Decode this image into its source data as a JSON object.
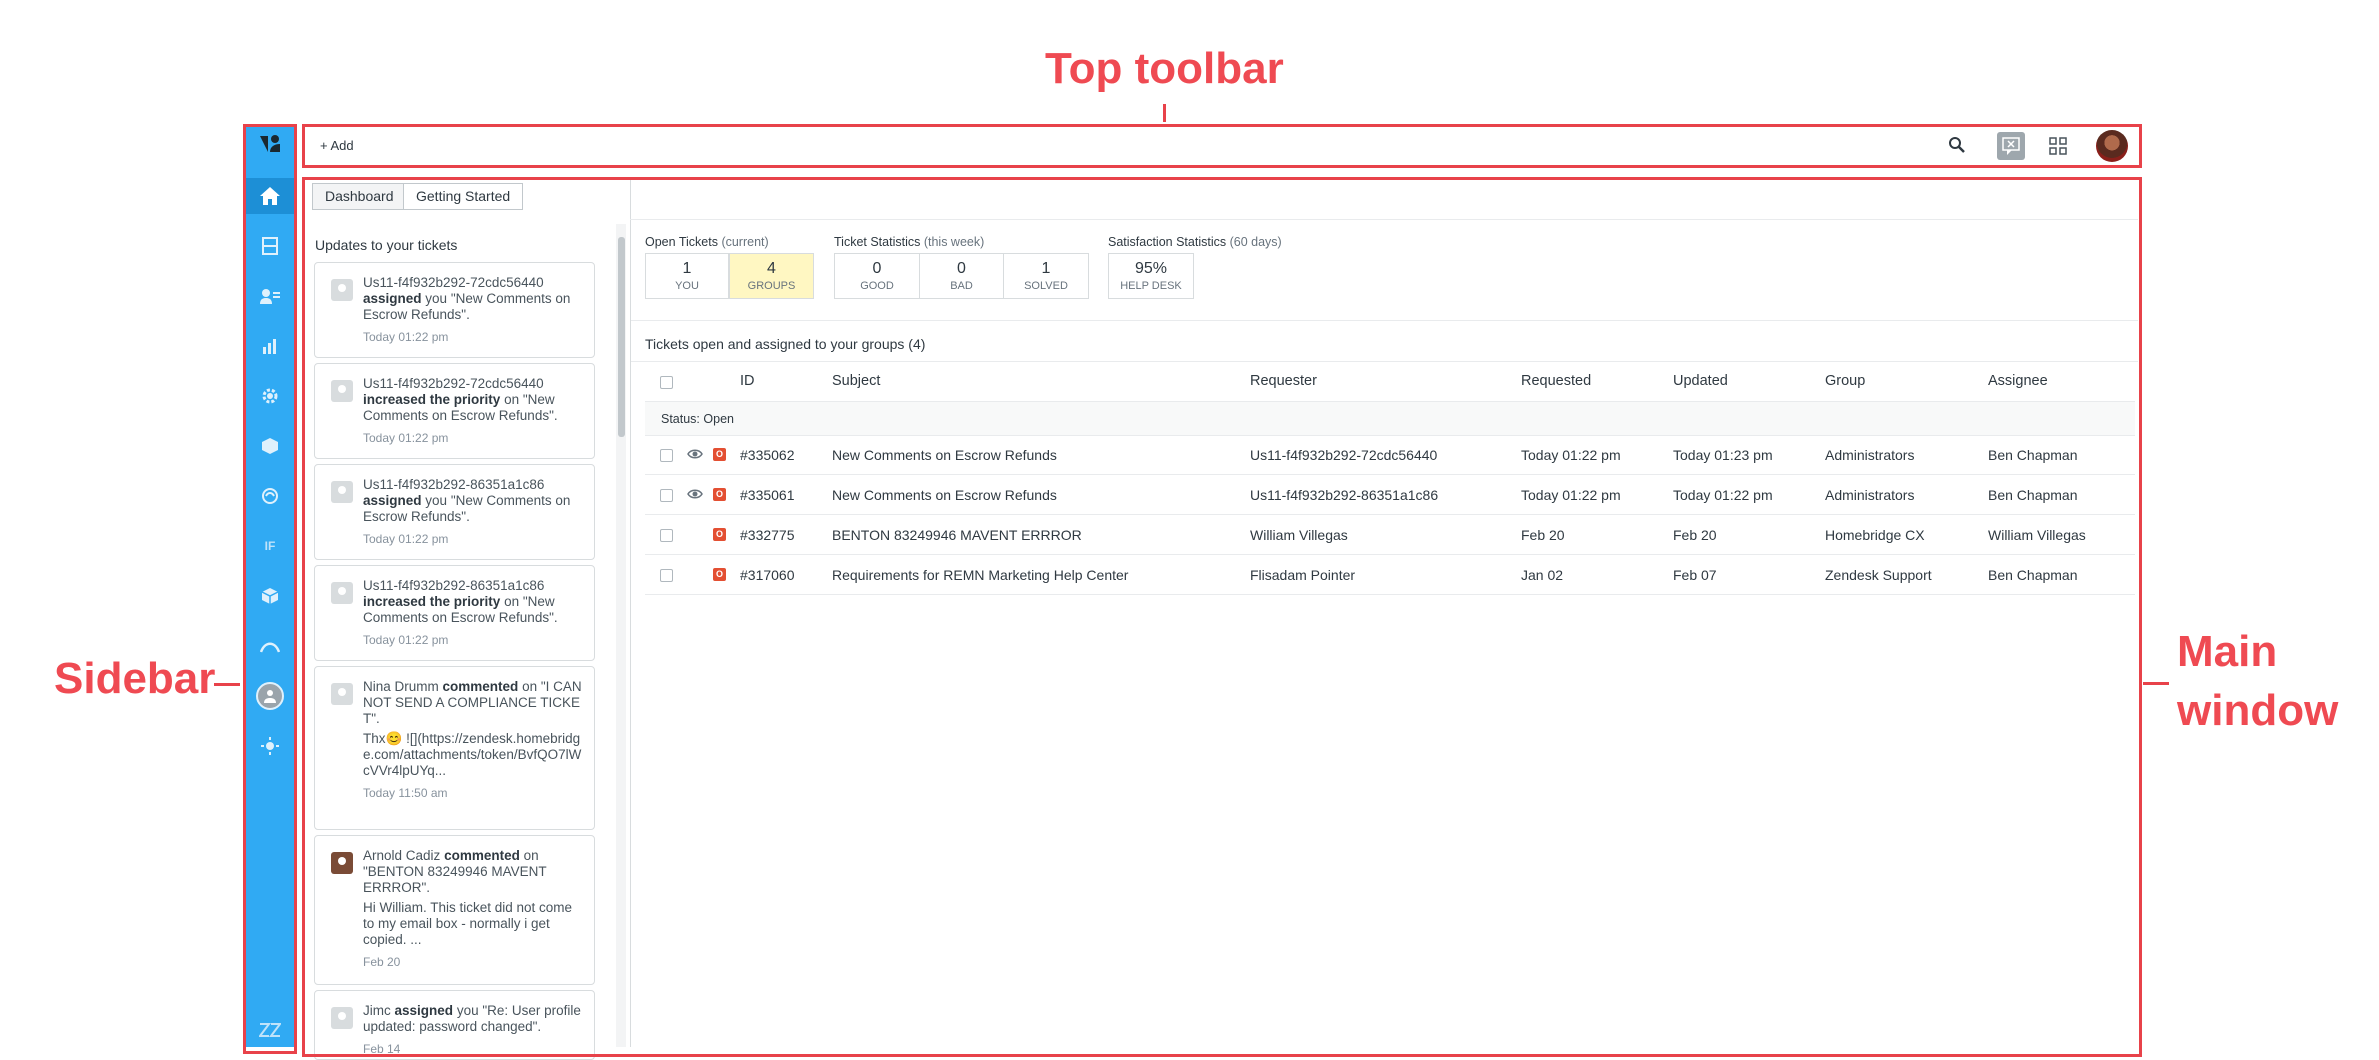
{
  "callouts": {
    "top_toolbar": "Top toolbar",
    "sidebar": "Sidebar",
    "main_window_line1": "Main",
    "main_window_line2": "window"
  },
  "toolbar": {
    "add_label": "+ Add"
  },
  "tabs": [
    {
      "label": "Dashboard"
    },
    {
      "label": "Getting Started"
    }
  ],
  "updates": {
    "heading": "Updates to your tickets",
    "items": [
      {
        "actor": "Us11-f4f932b292-72cdc56440",
        "action": "assigned",
        "rest": "you \"New Comments on Escrow Refunds\".",
        "time": "Today 01:22 pm"
      },
      {
        "actor": "Us11-f4f932b292-72cdc56440",
        "action": "increased the priority",
        "rest": "on \"New Comments on Escrow Refunds\".",
        "time": "Today 01:22 pm"
      },
      {
        "actor": "Us11-f4f932b292-86351a1c86",
        "action": "assigned",
        "rest": "you \"New Comments on Escrow Refunds\".",
        "time": "Today 01:22 pm"
      },
      {
        "actor": "Us11-f4f932b292-86351a1c86",
        "action": "increased the priority",
        "rest": "on \"New Comments on Escrow Refunds\".",
        "time": "Today 01:22 pm"
      },
      {
        "actor": "Nina Drumm",
        "action": "commented",
        "rest": "on \"I CANNOT SEND A COMPLIANCE TICKET\".",
        "body": "Thx😊 ![](https://zendesk.homebridge.com/attachments/token/BvfQO7lWcVVr4lpUYq...",
        "time": "Today 11:50 am"
      },
      {
        "actor": "Arnold Cadiz",
        "action": "commented",
        "rest": "on \"BENTON 83249946 MAVENT ERRROR\".",
        "body": "Hi William. This ticket did not come to my email box - normally i get copied. ...",
        "time": "Feb 20"
      },
      {
        "actor": "Jimc",
        "action": "assigned",
        "rest": "you \"Re: User profile updated: password changed\".",
        "time": "Feb 14"
      }
    ]
  },
  "stats": {
    "open": {
      "title": "Open Tickets",
      "sub": "(current)",
      "boxes": [
        {
          "n": "1",
          "l": "YOU"
        },
        {
          "n": "4",
          "l": "GROUPS"
        }
      ]
    },
    "ticket": {
      "title": "Ticket Statistics",
      "sub": "(this week)",
      "boxes": [
        {
          "n": "0",
          "l": "GOOD"
        },
        {
          "n": "0",
          "l": "BAD"
        },
        {
          "n": "1",
          "l": "SOLVED"
        }
      ]
    },
    "satisfaction": {
      "title": "Satisfaction Statistics",
      "sub": "(60 days)",
      "boxes": [
        {
          "n": "95%",
          "l": "HELP DESK"
        }
      ]
    }
  },
  "table": {
    "title": "Tickets open and assigned to your groups (4)",
    "headers": {
      "id": "ID",
      "subject": "Subject",
      "requester": "Requester",
      "requested": "Requested",
      "updated": "Updated",
      "group": "Group",
      "assignee": "Assignee"
    },
    "status_label": "Status:",
    "status_value": "Open",
    "rows": [
      {
        "id": "#335062",
        "subject": "New Comments on Escrow Refunds",
        "requester": "Us11-f4f932b292-72cdc56440",
        "requested": "Today 01:22 pm",
        "updated": "Today 01:23 pm",
        "group": "Administrators",
        "assignee": "Ben Chapman",
        "viewed": true
      },
      {
        "id": "#335061",
        "subject": "New Comments on Escrow Refunds",
        "requester": "Us11-f4f932b292-86351a1c86",
        "requested": "Today 01:22 pm",
        "updated": "Today 01:22 pm",
        "group": "Administrators",
        "assignee": "Ben Chapman",
        "viewed": true
      },
      {
        "id": "#332775",
        "subject": "BENTON 83249946 MAVENT ERRROR",
        "requester": "William Villegas",
        "requested": "Feb 20",
        "updated": "Feb 20",
        "group": "Homebridge CX",
        "assignee": "William Villegas",
        "viewed": false
      },
      {
        "id": "#317060",
        "subject": "Requirements for REMN Marketing Help Center",
        "requester": "Flisadam Pointer",
        "requested": "Jan 02",
        "updated": "Feb 07",
        "group": "Zendesk Support",
        "assignee": "Ben Chapman",
        "viewed": false
      }
    ],
    "badge_letter": "O"
  },
  "colors": {
    "sidebar": "#30aaf3",
    "callout": "#ef4a52",
    "badge": "#e34f32",
    "highlight": "#fff7c2"
  }
}
